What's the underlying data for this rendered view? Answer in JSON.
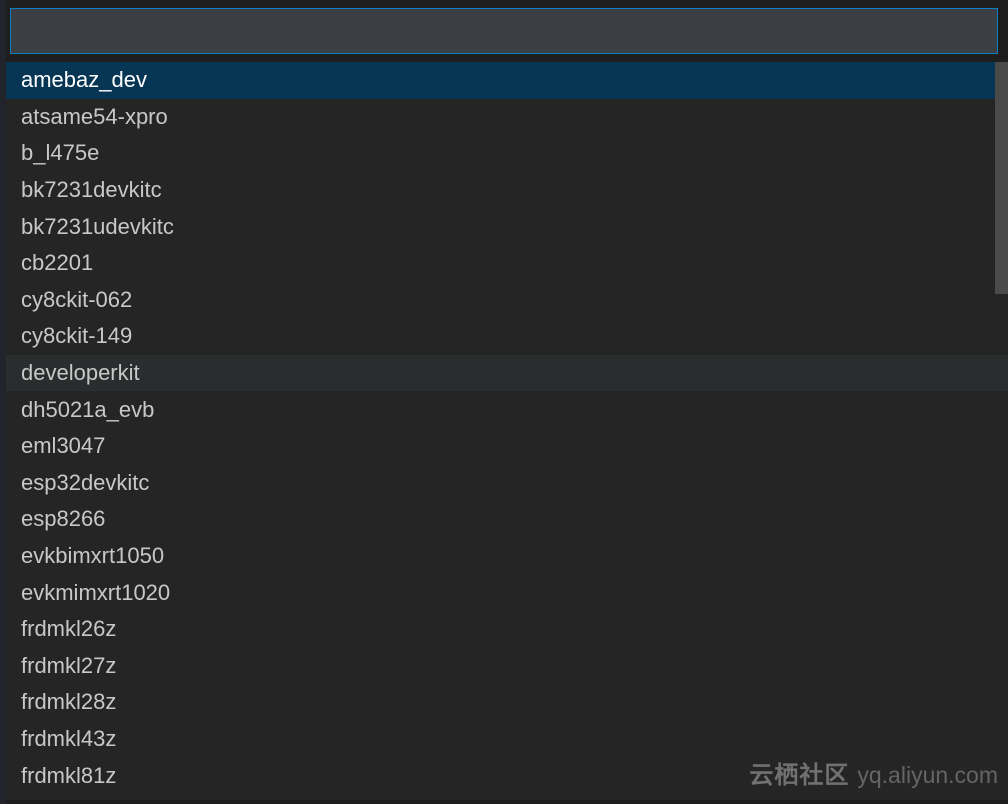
{
  "search": {
    "value": "",
    "placeholder": ""
  },
  "items": [
    {
      "label": "amebaz_dev",
      "selected": true,
      "hovered": false
    },
    {
      "label": "atsame54-xpro",
      "selected": false,
      "hovered": false
    },
    {
      "label": "b_l475e",
      "selected": false,
      "hovered": false
    },
    {
      "label": "bk7231devkitc",
      "selected": false,
      "hovered": false
    },
    {
      "label": "bk7231udevkitc",
      "selected": false,
      "hovered": false
    },
    {
      "label": "cb2201",
      "selected": false,
      "hovered": false
    },
    {
      "label": "cy8ckit-062",
      "selected": false,
      "hovered": false
    },
    {
      "label": "cy8ckit-149",
      "selected": false,
      "hovered": false
    },
    {
      "label": "developerkit",
      "selected": false,
      "hovered": true
    },
    {
      "label": "dh5021a_evb",
      "selected": false,
      "hovered": false
    },
    {
      "label": "eml3047",
      "selected": false,
      "hovered": false
    },
    {
      "label": "esp32devkitc",
      "selected": false,
      "hovered": false
    },
    {
      "label": "esp8266",
      "selected": false,
      "hovered": false
    },
    {
      "label": "evkbimxrt1050",
      "selected": false,
      "hovered": false
    },
    {
      "label": "evkmimxrt1020",
      "selected": false,
      "hovered": false
    },
    {
      "label": "frdmkl26z",
      "selected": false,
      "hovered": false
    },
    {
      "label": "frdmkl27z",
      "selected": false,
      "hovered": false
    },
    {
      "label": "frdmkl28z",
      "selected": false,
      "hovered": false
    },
    {
      "label": "frdmkl43z",
      "selected": false,
      "hovered": false
    },
    {
      "label": "frdmkl81z",
      "selected": false,
      "hovered": false
    }
  ],
  "watermark": {
    "brand": "云栖社区",
    "url": "yq.aliyun.com"
  },
  "colors": {
    "bg": "#1e1e1e",
    "listBg": "#252526",
    "searchBg": "#3b3f43",
    "searchBorder": "#0d7fc1",
    "selectedBg": "#073655",
    "hoverBg": "#2a2d2e",
    "text": "#c8c8c8"
  }
}
